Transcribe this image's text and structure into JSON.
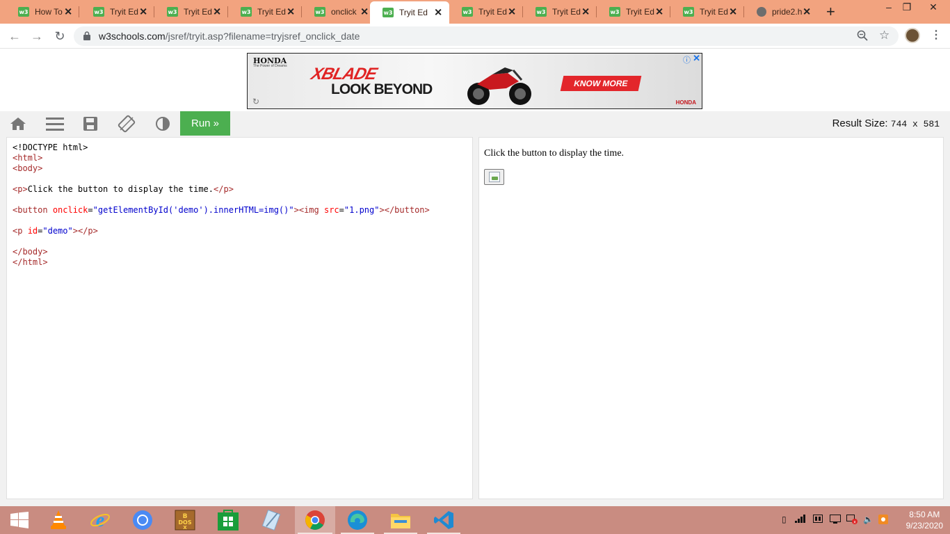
{
  "browser": {
    "tabs": [
      {
        "title": "How To",
        "icon": "w3",
        "active": false
      },
      {
        "title": "Tryit Ed",
        "icon": "w3",
        "active": false
      },
      {
        "title": "Tryit Ed",
        "icon": "w3",
        "active": false
      },
      {
        "title": "Tryit Ed",
        "icon": "w3",
        "active": false
      },
      {
        "title": "onclick",
        "icon": "w3",
        "active": false
      },
      {
        "title": "Tryit Ed",
        "icon": "w3",
        "active": true
      },
      {
        "title": "Tryit Ed",
        "icon": "w3",
        "active": false
      },
      {
        "title": "Tryit Ed",
        "icon": "w3",
        "active": false
      },
      {
        "title": "Tryit Ed",
        "icon": "w3",
        "active": false
      },
      {
        "title": "Tryit Ed",
        "icon": "w3",
        "active": false
      },
      {
        "title": "pride2.h",
        "icon": "globe",
        "active": false
      }
    ],
    "new_tab_label": "+",
    "window_controls": {
      "minimize": "–",
      "restore": "❐",
      "close": "✕"
    },
    "url": {
      "host": "w3schools.com",
      "path": "/jsref/tryit.asp?filename=tryjsref_onclick_date"
    }
  },
  "ad": {
    "brand": "HONDA",
    "brand_tagline": "The Power of Dreams",
    "product": "XBLADE",
    "slogan": "LOOK BEYOND",
    "cta": "KNOW MORE",
    "corner_brand": "HONDA"
  },
  "tryit": {
    "run_label": "Run »",
    "result_size_label": "Result Size:",
    "result_size_value": "744 x 581",
    "result_text": "Click the button to display the time."
  },
  "code_lines": [
    "<!DOCTYPE html>",
    "<html>",
    "<body>",
    "",
    "<p>Click the button to display the time.</p>",
    "",
    "<button onclick=\"getElementById('demo').innerHTML=img()\"><img src=\"1.png\"></button>",
    "",
    "<p id=\"demo\"></p>",
    "",
    "</body>",
    "</html>"
  ],
  "taskbar": {
    "apps": [
      "start",
      "vlc",
      "internet-explorer",
      "chromium",
      "dosbox",
      "store",
      "notepad",
      "chrome",
      "edge",
      "file-explorer",
      "vscode"
    ],
    "clock_time": "8:50 AM",
    "clock_date": "9/23/2020"
  },
  "colors": {
    "tab_strip": "#f2a37f",
    "w3_green": "#4caf50",
    "taskbar": "#c98c81",
    "ad_cta": "#e3262b"
  }
}
